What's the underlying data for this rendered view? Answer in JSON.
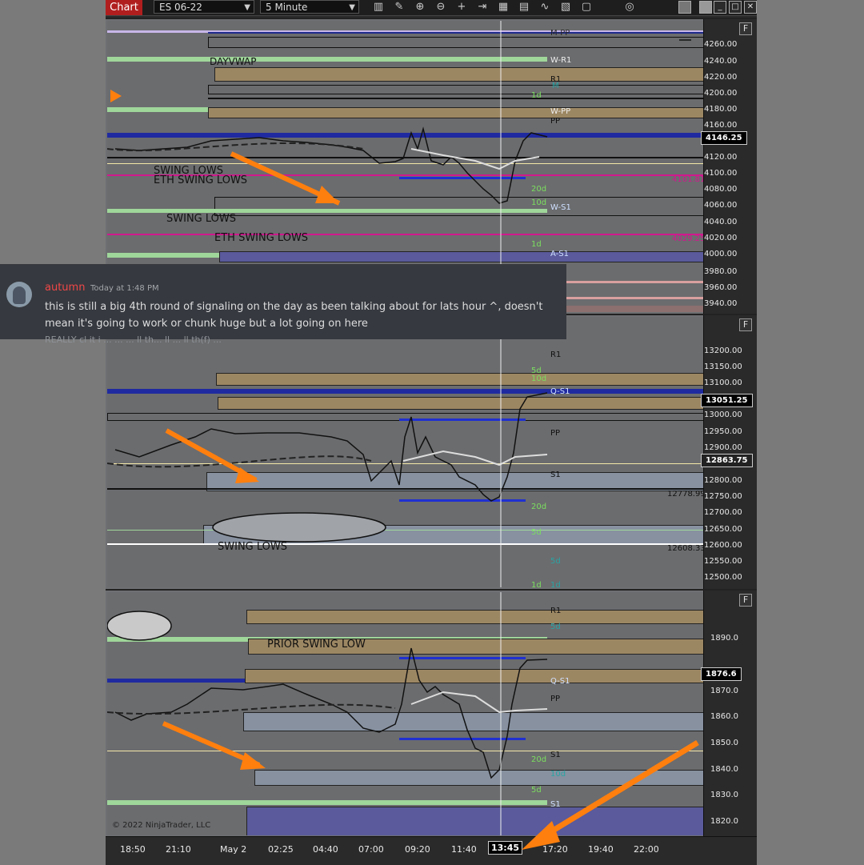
{
  "toolbar": {
    "tab_label": "Chart",
    "instrument": "ES 06-22",
    "interval": "5 Minute",
    "icons": [
      "bars-icon",
      "pencil-icon",
      "zoom-in-icon",
      "zoom-out-icon",
      "crosshair-icon",
      "add-chart-icon",
      "chart-style-icon",
      "strategy-icon",
      "indicators-icon",
      "templates-icon",
      "properties-icon",
      "snapshot-icon"
    ]
  },
  "chat": {
    "username": "autumn",
    "timestamp": "Today at 1:48 PM",
    "message": "this is still a big 4th round of signaling on the day as been talking about for lats hour ^, doesn't mean it's going to work or chunk huge but a lot going on here",
    "next_line": "REALLY cl it i ... ... ... ll th... ll ... ll th(f) ..."
  },
  "panels": [
    {
      "id": "es",
      "ticks": [
        "4260.00",
        "4240.00",
        "4220.00",
        "4200.00",
        "4180.00",
        "4160.00",
        "4140.00",
        "4120.00",
        "4100.00",
        "4080.00",
        "4060.00",
        "4040.00",
        "4020.00",
        "4000.00",
        "3980.00",
        "3960.00",
        "3940.00"
      ],
      "current_price": "4146.25",
      "annotations": [
        "DAYVWAP",
        "SWING LOWS",
        "ETH SWING LOWS",
        "SWING LOWS",
        "ETH SWING LOWS"
      ],
      "side_labels": [
        "M-PP",
        "W-R1",
        "R1",
        "M",
        "1d",
        "W-PP",
        "PP",
        "20d",
        "10d",
        "W-S1",
        "1d",
        "A-S1"
      ],
      "price_marks": [
        "4101.81",
        "4029.25"
      ]
    },
    {
      "id": "nq",
      "ticks": [
        "13200.00",
        "13150.00",
        "13100.00",
        "13050.00",
        "13000.00",
        "12950.00",
        "12900.00",
        "12850.00",
        "12800.00",
        "12750.00",
        "12700.00",
        "12650.00",
        "12600.00",
        "12550.00",
        "12500.00"
      ],
      "current_price": "13051.25",
      "secondary_price": "12863.75",
      "annotations": [
        "SWING LOWS"
      ],
      "side_labels": [
        "R1",
        "5d",
        "10d",
        "Q-S1",
        "PP",
        "S1",
        "20d",
        "5d",
        "5d",
        "1d",
        "1d"
      ],
      "price_marks": [
        "12778.99",
        "12608.33"
      ]
    },
    {
      "id": "rty",
      "ticks": [
        "1890.0",
        "1880.0",
        "1870.0",
        "1860.0",
        "1850.0",
        "1840.0",
        "1830.0",
        "1820.0"
      ],
      "current_price": "1876.6",
      "annotations": [
        "PRIOR SWING LOW"
      ],
      "side_labels": [
        "R1",
        "5d",
        "Q-S1",
        "PP",
        "S1",
        "20d",
        "10d",
        "5d",
        "S1"
      ],
      "copyright": "© 2022 NinjaTrader, LLC"
    }
  ],
  "x_axis": {
    "ticks": [
      "18:50",
      "21:10",
      "May 2",
      "02:25",
      "04:40",
      "07:00",
      "09:20",
      "11:40",
      "17:20",
      "19:40",
      "22:00"
    ],
    "current_time": "13:45"
  },
  "colors": {
    "arrow": "#ff7f0e",
    "tab_red": "#b11e1e",
    "vwap_blue": "#1f2aa0",
    "tan_band": "#9c8763",
    "green_band": "#9fd69a",
    "magenta": "#d1188e"
  }
}
